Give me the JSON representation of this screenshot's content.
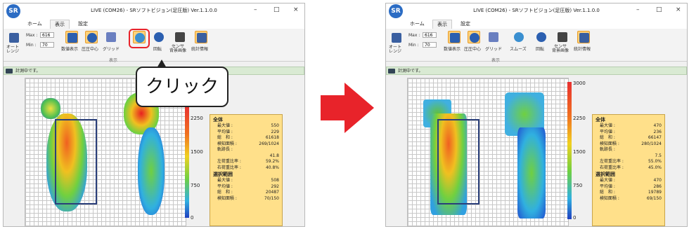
{
  "app": {
    "title": "LIVE (COM26) - SRソフトビジョン(足圧版) Ver.1.1.0.0",
    "logo": "SR",
    "tabs": [
      "ホーム",
      "表示",
      "設定"
    ],
    "active_tab": "表示",
    "window_controls": [
      "–",
      "□",
      "×"
    ]
  },
  "ribbon": {
    "auto_range_label": "オート\nレンジ",
    "max_label": "Max :",
    "max_value": "616",
    "min_label": "Min :",
    "min_value": "70",
    "buttons": [
      "数値表示",
      "圧圧中心",
      "グリッド",
      "スムーズ",
      "回転",
      "センサ\n背景画像",
      "統計情報"
    ],
    "group_label": "表示"
  },
  "status_text": "計測中です。",
  "callout_text": "クリック",
  "before": {
    "colorbar_ticks": [
      "2250",
      "1500",
      "750",
      "0"
    ],
    "info": {
      "all_header": "全体",
      "max_label": "最大値 :",
      "max": "550",
      "avg_label": "平均値 :",
      "avg": "229",
      "sum_label": "総　和 :",
      "sum": "61618",
      "area_label": "検知面積 :",
      "area": "269/1024",
      "trail_label": "軌跡長 :",
      "trail": "41.8",
      "left_label": "左荷重比率 :",
      "left": "59.2%",
      "right_label": "右荷重比率 :",
      "right": "40.8%",
      "sel_header": "選択範囲",
      "smax": "508",
      "savg": "292",
      "ssum": "20487",
      "sarea": "70/150"
    }
  },
  "after": {
    "colorbar_ticks": [
      "3000",
      "2250",
      "1500",
      "750",
      "0"
    ],
    "info": {
      "all_header": "全体",
      "max_label": "最大値 :",
      "max": "470",
      "avg_label": "平均値 :",
      "avg": "236",
      "sum_label": "総　和 :",
      "sum": "66147",
      "area_label": "検知面積 :",
      "area": "280/1024",
      "trail_label": "軌跡長 :",
      "trail": "7.5",
      "left_label": "左荷重比率 :",
      "left": "55.0%",
      "right_label": "右荷重比率 :",
      "right": "45.0%",
      "sel_header": "選択範囲",
      "smax": "470",
      "savg": "286",
      "ssum": "19789",
      "sarea": "69/150"
    }
  },
  "colors": {
    "arrow": "#e8232a",
    "highlight": "#e8232a",
    "info_bg": "#ffe08a"
  }
}
